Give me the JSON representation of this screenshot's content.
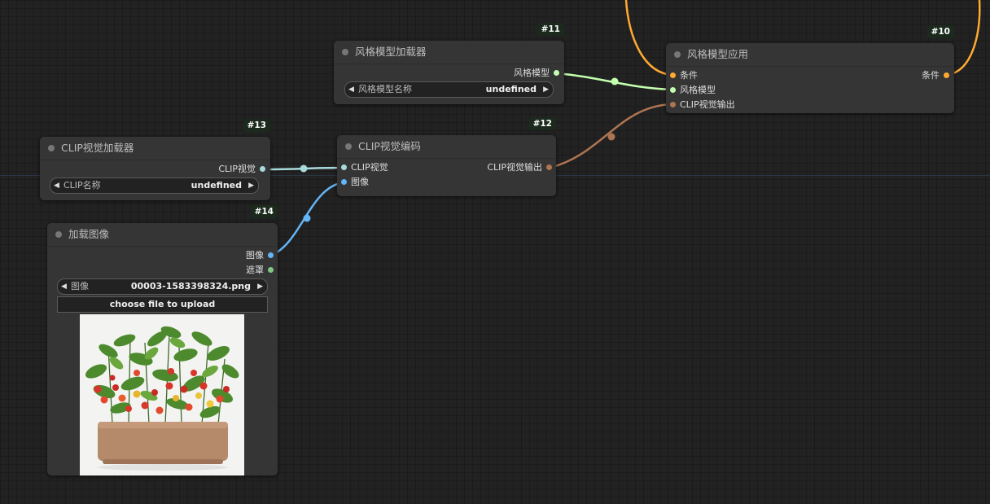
{
  "nodes": {
    "style_loader": {
      "id_badge": "#11",
      "title": "风格模型加载器",
      "output_label": "风格模型",
      "widget": {
        "label": "风格模型名称",
        "value": "undefined"
      },
      "color": "#353535"
    },
    "style_apply": {
      "id_badge": "#10",
      "title": "风格模型应用",
      "inputs": [
        "条件",
        "风格模型",
        "CLIP视觉输出"
      ],
      "output_label": "条件"
    },
    "clip_loader": {
      "id_badge": "#13",
      "title": "CLIP视觉加载器",
      "output_label": "CLIP视觉",
      "widget": {
        "label": "CLIP名称",
        "value": "undefined"
      }
    },
    "clip_encode": {
      "id_badge": "#12",
      "title": "CLIP视觉编码",
      "inputs": [
        "CLIP视觉",
        "图像"
      ],
      "output_label": "CLIP视觉输出"
    },
    "load_image": {
      "id_badge": "#14",
      "title": "加载图像",
      "outputs": [
        "图像",
        "遮罩"
      ],
      "widget": {
        "label": "图像",
        "value": "00003-1583398324.png"
      },
      "upload_label": "choose file to upload"
    }
  },
  "slot_colors": {
    "conditioning": "#ffa931",
    "style_model": "#c2ffae",
    "clip_vision_output": "#ad7452",
    "clip_vision": "#a8dadc",
    "image": "#64b5f6",
    "mask": "#81c784"
  },
  "icons": {
    "arrow_left": "◀",
    "arrow_right": "▶"
  }
}
